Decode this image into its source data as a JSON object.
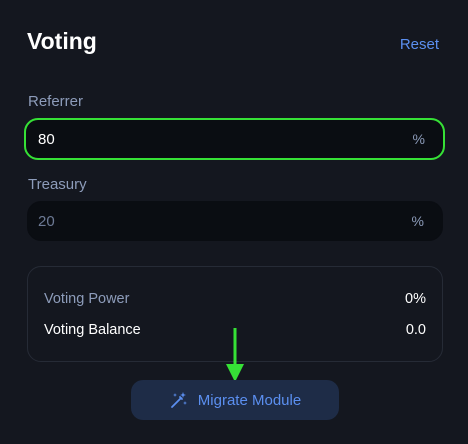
{
  "header": {
    "title": "Voting",
    "reset_label": "Reset"
  },
  "fields": {
    "referrer": {
      "label": "Referrer",
      "value": "80",
      "unit": "%"
    },
    "treasury": {
      "label": "Treasury",
      "value": "20",
      "unit": "%"
    }
  },
  "summary": {
    "voting_power": {
      "label": "Voting Power",
      "value": "0%"
    },
    "voting_balance": {
      "label": "Voting Balance",
      "value": "0.0"
    }
  },
  "migrate_button": {
    "label": "Migrate Module",
    "icon": "magic-wand-icon"
  },
  "colors": {
    "background": "#14171f",
    "accent": "#5b8ff0",
    "focus_border": "#36e136",
    "annotation_arrow": "#36e136"
  }
}
